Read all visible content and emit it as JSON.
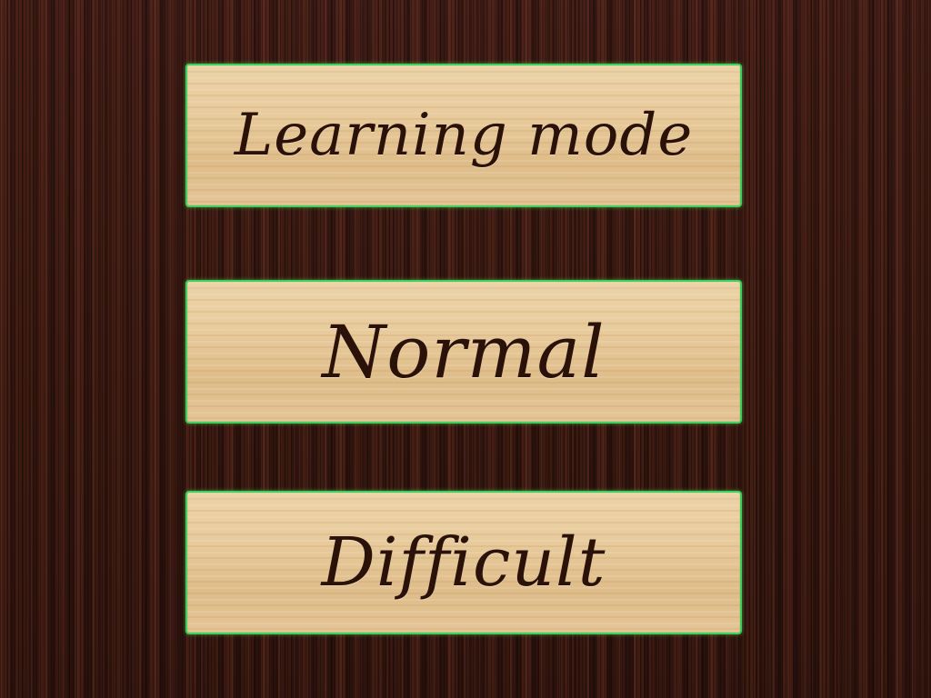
{
  "menu": {
    "options": [
      {
        "label": "Learning mode"
      },
      {
        "label": "Normal"
      },
      {
        "label": "Difficult"
      }
    ]
  },
  "colors": {
    "table_wood": "#3a1a12",
    "plank_wood": "#e6c99b",
    "highlight_border": "#3fcf5a",
    "label_ink": "#2b1208"
  }
}
